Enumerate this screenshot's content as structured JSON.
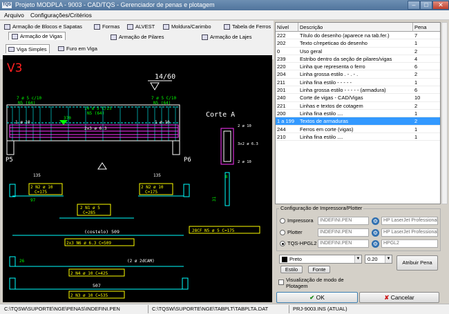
{
  "window": {
    "title": "Projeto MODPLA - 9003 - CAD/TQS - Gerenciador de penas e plotagem",
    "icon_label": "TQS"
  },
  "menu": [
    "Arquivo",
    "Configurações/Critérios"
  ],
  "tabs": {
    "row1": [
      "Armação de Blocos e Sapatas",
      "Formas",
      "ALVEST",
      "Moldura/Carimbo",
      "Tabela de Ferros"
    ],
    "row2": [
      "Armação de Vigas",
      "Armação de Pilares",
      "Armação de Lajes"
    ],
    "active": "Armação de Vigas"
  },
  "subtabs": {
    "items": [
      "Viga Simples",
      "Furo em Viga"
    ],
    "active": "Viga Simples"
  },
  "drawing": {
    "title": "V3",
    "labels": {
      "section_ref": "14/60",
      "top_bar_left_1": "7 ø 5 c/10",
      "top_bar_left_2": "N5 (64)",
      "top_bar_mid_1": "14 ø 5 C/25",
      "top_bar_mid_2": "N5 (64)",
      "top_bar_right_1": "7 ø 5 C/10",
      "top_bar_right_2": "N5 (64)",
      "dim_mid": "370",
      "bar_upper": "2x3 ø 6.3",
      "support_left": "P5",
      "support_right": "P6",
      "corte": "Corte A",
      "corte_bar_top": "2 ø 10",
      "corte_bar_mid": "3x2 ø 6.3",
      "corte_bar_bot": "2 ø 10",
      "dim_left": "135",
      "dim_right": "135",
      "n2_left_1": "2 N2 ø 10",
      "n2_left_2": "C=175",
      "n2_right_1": "2 N2 ø 10",
      "n2_right_2": "C=175",
      "n1": "2 N1 ø 5",
      "n1_c": "C=285",
      "stirrup": "28CF N5 ø 5   C=175",
      "costelo": "(costelo) 509",
      "n6": "2x3 N6 ø 6.3 C=509",
      "dim_small": "26",
      "cam": "(2 ø 2dCAM)",
      "n4": "2 N4 ø 10   C=425",
      "dim_bottom": "507",
      "n3": "2 N3 ø 10   C=535",
      "dim_side": "31",
      "dim_b": "8",
      "dim_e": "E"
    }
  },
  "pen_table": {
    "headers": [
      "Nível",
      "Descrição",
      "Pena"
    ],
    "rows": [
      {
        "nivel": "222",
        "descricao": "Título do desenho (aparece na tab.fer.)",
        "pena": "7"
      },
      {
        "nivel": "202",
        "descricao": "Texto c/repeticao do desenho",
        "pena": "1"
      },
      {
        "nivel": "0",
        "descricao": "Uso geral",
        "pena": "2"
      },
      {
        "nivel": "239",
        "descricao": "Estribo dentro da seção de pilares/vigas",
        "pena": "4"
      },
      {
        "nivel": "220",
        "descricao": "Linha que representa o ferro",
        "pena": "6"
      },
      {
        "nivel": "204",
        "descricao": "Linha grossa estilo . - . - .",
        "pena": "2"
      },
      {
        "nivel": "211",
        "descricao": "Linha fina estilo - - - - -",
        "pena": "1"
      },
      {
        "nivel": "201",
        "descricao": "Linha grossa estilo - - - - - (armadura)",
        "pena": "6"
      },
      {
        "nivel": "240",
        "descricao": "Corte de vigas - CAD/Vigas",
        "pena": "10"
      },
      {
        "nivel": "221",
        "descricao": "Linhas e textos de cotagem",
        "pena": "2"
      },
      {
        "nivel": "200",
        "descricao": "Linha fina estilo ....",
        "pena": "1"
      },
      {
        "nivel": "1 a 199",
        "descricao": "Textos de armaduras",
        "pena": "2"
      },
      {
        "nivel": "244",
        "descricao": "Ferros em corte (vigas)",
        "pena": "1"
      },
      {
        "nivel": "210",
        "descricao": "Linha fina estilo ....",
        "pena": "1"
      }
    ],
    "selected_index": 11
  },
  "printer_config": {
    "legend": "Configuração de Impressora/Plotter",
    "options": [
      {
        "label": "Impressora",
        "pen_file": "INDEFINI.PEN",
        "device": "HP LaserJet Professional",
        "selected": false
      },
      {
        "label": "Plotter",
        "pen_file": "INDEFINI.PEN",
        "device": "HP LaserJet Professional",
        "selected": false
      },
      {
        "label": "TQS-HPGL2",
        "pen_file": "INDEFINI.PEN",
        "device": "HPGL2",
        "selected": true
      }
    ]
  },
  "pen_controls": {
    "color_name": "Preto",
    "width": "0.20",
    "estilo": "Estilo",
    "fonte": "Fonte",
    "assign": "Atribuir Pena",
    "visualizacao": "Visualização de modo de Plotagem"
  },
  "buttons": {
    "ok": "OK",
    "cancel": "Cancelar"
  },
  "status": {
    "pen_file": "C:\\TQSW\\SUPORTE\\NGE\\PENAS\\INDEFINI.PEN",
    "table_file": "C:\\TQSW\\SUPORTE\\NGE\\TABPLT\\TABPLTA.DAT",
    "project": "PRJ-9003.INS (ATUAL)"
  },
  "colors": {
    "selection": "#3399ff",
    "canvas": "#000000",
    "yellow": "#ffff00",
    "magenta": "#ff33ff",
    "cyan": "#00ffff",
    "green": "#00ff00",
    "red": "#ff2020"
  }
}
